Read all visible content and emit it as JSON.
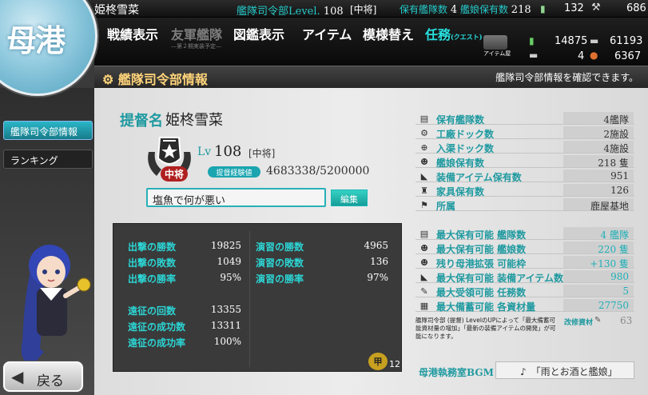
{
  "header": {
    "admiral_name": "姫柊雪菜",
    "hq_level_label": "艦隊司令部Level.",
    "hq_level_value": "108",
    "hq_rank": "[中将]",
    "ships_fleets_label": "保有艦隊数",
    "ships_fleets_value": "4",
    "ships_count_label": "艦娘保有数",
    "ships_count_value": "218",
    "buckets": "132",
    "dev_mats": "686",
    "fuel": "14875",
    "ammo": "61193",
    "screws": "4",
    "bauxite": "6367"
  },
  "nav": {
    "record": "戦績表示",
    "friend_fleet": "友軍艦隊",
    "friend_fleet_sub": "—第２期実装予定—",
    "album": "図鑑表示",
    "items": "アイテム",
    "interior": "模様替え",
    "quest": "任務",
    "quest_sub": "(クエスト)",
    "item_shop": "アイテム屋"
  },
  "section": {
    "title": "艦隊司令部情報",
    "hint": "艦隊司令部情報を確認できます。"
  },
  "sidebar": {
    "homeport": "母港",
    "hq_info": "艦隊司令部情報",
    "ranking": "ランキング",
    "back": "戻る"
  },
  "profile": {
    "admiral_label": "提督名",
    "admiral_name": "姫柊雪菜",
    "rank_seal": "中将",
    "lv_label": "Lv",
    "lv_value": "108",
    "lv_rank": "[中将]",
    "exp_label": "提督経験値",
    "exp_value": "4683338/5200000",
    "comment": "塩魚で何が悪い",
    "edit_button": "編集"
  },
  "stats": {
    "sortie_wins_label": "出撃の勝数",
    "sortie_wins": "19825",
    "sortie_losses_label": "出撃の敗数",
    "sortie_losses": "1049",
    "sortie_rate_label": "出撃の勝率",
    "sortie_rate": "95%",
    "practice_wins_label": "演習の勝数",
    "practice_wins": "4965",
    "practice_losses_label": "演習の敗数",
    "practice_losses": "136",
    "practice_rate_label": "演習の勝率",
    "practice_rate": "97%",
    "expedition_count_label": "遠征の回数",
    "expedition_count": "13355",
    "expedition_success_label": "遠征の成功数",
    "expedition_success": "13311",
    "expedition_rate_label": "遠征の成功率",
    "expedition_rate": "100%",
    "seal_icon": "甲",
    "seal_count": "12"
  },
  "info": {
    "fleets_label": "保有艦隊数",
    "fleets": "4艦隊",
    "docks_label": "工廠ドック数",
    "docks": "2施設",
    "repair_label": "入渠ドック数",
    "repair": "4施設",
    "ships_label": "艦娘保有数",
    "ships": "218 隻",
    "equip_label": "装備アイテム保有数",
    "equip": "951",
    "furniture_label": "家具保有数",
    "furniture": "126",
    "base_label": "所属",
    "base": "鹿屋基地",
    "max_fleets_label": "最大保有可能 艦隊数",
    "max_fleets": "4 艦隊",
    "max_ships_label": "最大保有可能 艦娘数",
    "max_ships": "220 隻",
    "expansion_label": "残り母港拡張 可能枠",
    "expansion": "+130 隻",
    "max_equip_label": "最大保有可能 装備アイテム数",
    "max_equip": "980",
    "max_quests_label": "最大受領可能 任務数",
    "max_quests": "5",
    "max_res_label": "最大備蓄可能 各資材量",
    "max_res": "27750",
    "note": "艦隊司令部 (提督) LevelのUPによって「最大備蓄可能資材量の増加」「最新の装備アイテムの開発」が可能になります。",
    "mod_label": "改修資材",
    "mod_value": "63"
  },
  "bgm": {
    "label": "母港執務室BGM",
    "note_icon": "♪",
    "title": "「雨とお酒と艦娘」"
  }
}
